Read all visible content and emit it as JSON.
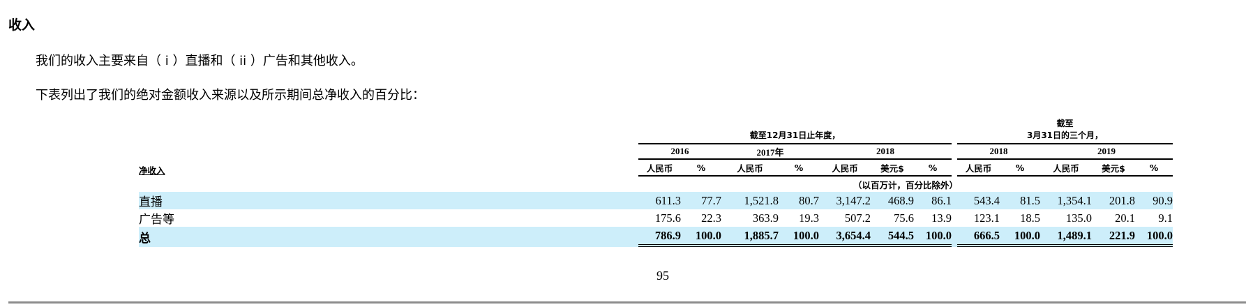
{
  "heading": "收入",
  "paragraphs": [
    "我们的收入主要来自（ i ）直播和（ ii ）广告和其他收入。",
    "下表列出了我们的绝对金额收入来源以及所示期间总净收入的百分比："
  ],
  "table": {
    "group1_title": "截至12月31日止年度，",
    "group2_title_line1": "截至",
    "group2_title_line2": "3月31日的三个月，",
    "years": [
      "2016",
      "2017年",
      "2018",
      "2018",
      "2019"
    ],
    "row_header": "净收入",
    "columns": [
      "人民币",
      "%",
      "人民币",
      "%",
      "人民币",
      "美元$",
      "%",
      "人民币",
      "%",
      "人民币",
      "美元$",
      "%"
    ],
    "unit_note": "（以百万计，百分比除外）",
    "rows": [
      {
        "label": "直播",
        "values": [
          "611.3",
          "77.7",
          "1,521.8",
          "80.7",
          "3,147.2",
          "468.9",
          "86.1",
          "543.4",
          "81.5",
          "1,354.1",
          "201.8",
          "90.9"
        ]
      },
      {
        "label": "广告等",
        "values": [
          "175.6",
          "22.3",
          "363.9",
          "19.3",
          "507.2",
          "75.6",
          "13.9",
          "123.1",
          "18.5",
          "135.0",
          "20.1",
          "9.1"
        ]
      },
      {
        "label": "总",
        "values": [
          "786.9",
          "100.0",
          "1,885.7",
          "100.0",
          "3,654.4",
          "544.5",
          "100.0",
          "666.5",
          "100.0",
          "1,489.1",
          "221.9",
          "100.0"
        ]
      }
    ]
  },
  "page_number": "95",
  "colors": {
    "row_highlight": "#cdeefa",
    "footer_rule": "#8c8c8c"
  }
}
